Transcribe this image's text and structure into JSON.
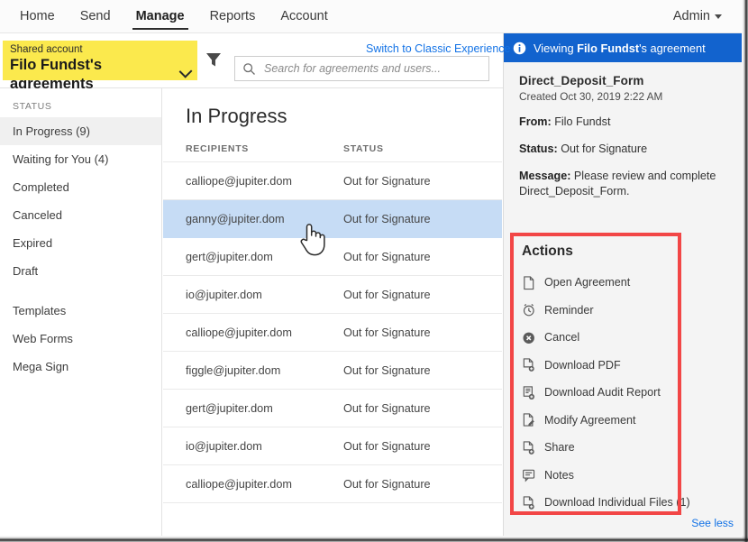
{
  "nav": {
    "tabs": [
      {
        "label": "Home",
        "active": false
      },
      {
        "label": "Send",
        "active": false
      },
      {
        "label": "Manage",
        "active": true
      },
      {
        "label": "Reports",
        "active": false
      },
      {
        "label": "Account",
        "active": false
      }
    ],
    "admin_label": "Admin"
  },
  "toolbar": {
    "shared_account_label": "Shared account",
    "shared_account_name": "Filo Fundst's agreements",
    "filter_icon": "filter-icon",
    "search_placeholder": "Search for agreements and users...",
    "search_value": "",
    "search_icon": "search-icon",
    "switch_classic_label": "Switch to Classic Experience"
  },
  "sidebar": {
    "heading": "STATUS",
    "items": [
      {
        "label": "In Progress (9)",
        "selected": true
      },
      {
        "label": "Waiting for You (4)",
        "selected": false
      },
      {
        "label": "Completed",
        "selected": false
      },
      {
        "label": "Canceled",
        "selected": false
      },
      {
        "label": "Expired",
        "selected": false
      },
      {
        "label": "Draft",
        "selected": false
      }
    ],
    "items2": [
      {
        "label": "Templates",
        "selected": false
      },
      {
        "label": "Web Forms",
        "selected": false
      },
      {
        "label": "Mega Sign",
        "selected": false
      }
    ]
  },
  "list": {
    "title": "In Progress",
    "columns": [
      "RECIPIENTS",
      "STATUS"
    ],
    "rows": [
      {
        "recipient": "calliope@jupiter.dom",
        "status": "Out for Signature",
        "selected": false
      },
      {
        "recipient": "ganny@jupiter.dom",
        "status": "Out for Signature",
        "selected": true
      },
      {
        "recipient": "gert@jupiter.dom",
        "status": "Out for Signature",
        "selected": false
      },
      {
        "recipient": "io@jupiter.dom",
        "status": "Out for Signature",
        "selected": false
      },
      {
        "recipient": "calliope@jupiter.dom",
        "status": "Out for Signature",
        "selected": false
      },
      {
        "recipient": "figgle@jupiter.dom",
        "status": "Out for Signature",
        "selected": false
      },
      {
        "recipient": "gert@jupiter.dom",
        "status": "Out for Signature",
        "selected": false
      },
      {
        "recipient": "io@jupiter.dom",
        "status": "Out for Signature",
        "selected": false
      },
      {
        "recipient": "calliope@jupiter.dom",
        "status": "Out for Signature",
        "selected": false
      }
    ]
  },
  "detail": {
    "banner_prefix": "Viewing ",
    "banner_name": "Filo Fundst",
    "banner_suffix": "'s agreement",
    "banner_icon": "info-icon",
    "doc_title": "Direct_Deposit_Form",
    "created": "Created Oct 30, 2019 2:22 AM",
    "from_label": "From:",
    "from_value": "Filo Fundst",
    "status_label": "Status:",
    "status_value": "Out for Signature",
    "message_label": "Message:",
    "message_value": "Please review and complete Direct_Deposit_Form.",
    "see_less_label": "See less"
  },
  "actions": {
    "title": "Actions",
    "highlight_color": "#f24646",
    "items": [
      {
        "label": "Open Agreement",
        "icon": "document-icon"
      },
      {
        "label": "Reminder",
        "icon": "alarm-clock-icon"
      },
      {
        "label": "Cancel",
        "icon": "cancel-circle-x-icon"
      },
      {
        "label": "Download PDF",
        "icon": "document-download-icon"
      },
      {
        "label": "Download Audit Report",
        "icon": "audit-report-download-icon"
      },
      {
        "label": "Modify Agreement",
        "icon": "document-edit-icon"
      },
      {
        "label": "Share",
        "icon": "document-share-icon"
      },
      {
        "label": "Notes",
        "icon": "notes-icon"
      },
      {
        "label": "Download Individual Files (1)",
        "icon": "document-download-files-icon"
      }
    ]
  },
  "colors": {
    "shared_account_yellow": "#fbe94d",
    "banner_blue": "#1263ce",
    "selection_blue": "#c6dcf5",
    "link_blue": "#1473e6",
    "highlight_red": "#f24646"
  }
}
